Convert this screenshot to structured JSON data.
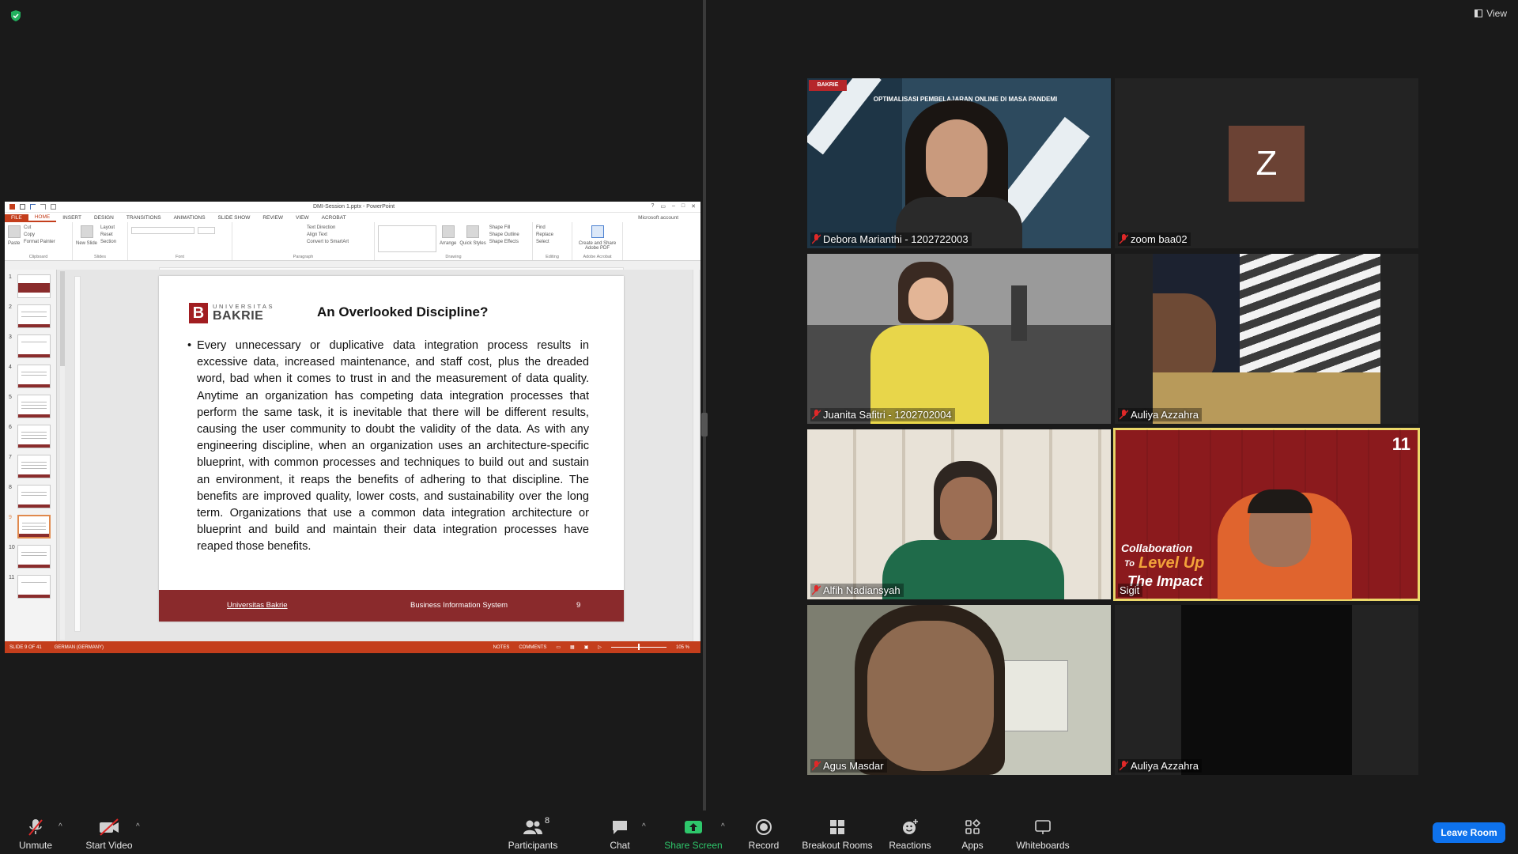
{
  "top": {
    "view_label": "View"
  },
  "powerpoint": {
    "doc_title": "DMI-Session 1.pptx - PowerPoint",
    "tabs": [
      "FILE",
      "HOME",
      "INSERT",
      "DESIGN",
      "TRANSITIONS",
      "ANIMATIONS",
      "SLIDE SHOW",
      "REVIEW",
      "VIEW",
      "ACROBAT"
    ],
    "account": "Microsoft account",
    "ribbon": {
      "paste": "Paste",
      "cut": "Cut",
      "copy": "Copy",
      "format_painter": "Format Painter",
      "clipboard": "Clipboard",
      "new_slide": "New Slide",
      "layout": "Layout",
      "reset": "Reset",
      "section": "Section",
      "slides": "Slides",
      "font": "Font",
      "paragraph": "Paragraph",
      "text_direction": "Text Direction",
      "align_text": "Align Text",
      "convert_smartart": "Convert to SmartArt",
      "drawing": "Drawing",
      "arrange": "Arrange",
      "quick_styles": "Quick Styles",
      "shape_fill": "Shape Fill",
      "shape_outline": "Shape Outline",
      "shape_effects": "Shape Effects",
      "find": "Find",
      "replace": "Replace",
      "select": "Select",
      "editing": "Editing",
      "create_pdf": "Create and Share Adobe PDF",
      "adobe_acrobat": "Adobe Acrobat"
    },
    "thumb_numbers": [
      "1",
      "2",
      "3",
      "4",
      "5",
      "6",
      "7",
      "8",
      "9",
      "10",
      "11"
    ],
    "selected_slide": 9,
    "slide": {
      "logo_top": "UNIVERSITAS",
      "logo_bottom": "BAKRIE",
      "title": "An Overlooked Discipline?",
      "body": "Every unnecessary or duplicative data integration process results in excessive data, increased maintenance, and staff cost, plus the dreaded word, bad when it comes to trust in and the measurement of data quality. Anytime an organization has competing data integration processes that perform the same task, it is inevitable that there will be different results, causing the user community to doubt the validity of the data. As with any engineering discipline, when an organization uses an architecture-specific blueprint, with common processes and techniques to build out and sustain an environment, it reaps the benefits of adhering to that discipline. The benefits are improved quality, lower costs, and sustainability over the long term. Organizations that use a common data integration architecture or blueprint and build and maintain their data integration processes have reaped those benefits.",
      "footer_left": "Universitas Bakrie",
      "footer_center": "Business Information System",
      "footer_page": "9"
    },
    "status": {
      "slide_of": "SLIDE 9 OF 41",
      "language": "GERMAN (GERMANY)",
      "notes": "NOTES",
      "comments": "COMMENTS",
      "zoom": "105 %"
    }
  },
  "participants": [
    {
      "name": "Debora Marianthi - 1202722003"
    },
    {
      "name": "zoom baa02",
      "avatar_letter": "Z"
    },
    {
      "name": "Juanita Safitri - 1202702004"
    },
    {
      "name": "Auliya Azzahra"
    },
    {
      "name": "Alfih Nadiansyah"
    },
    {
      "name": "Sigit",
      "banner_1": "Collaboration",
      "banner_2": "To",
      "banner_3": "Level Up",
      "banner_4": "The Impact",
      "badge": "11"
    },
    {
      "name": "Agus Masdar"
    },
    {
      "name": "Auliya Azzahra"
    }
  ],
  "debora_banner": "OPTIMALISASI PEMBELAJARAN ONLINE DI MASA PANDEMI",
  "toolbar": {
    "unmute": "Unmute",
    "start_video": "Start Video",
    "participants": "Participants",
    "participants_count": "8",
    "chat": "Chat",
    "share_screen": "Share Screen",
    "record": "Record",
    "breakout_rooms": "Breakout Rooms",
    "reactions": "Reactions",
    "apps": "Apps",
    "whiteboards": "Whiteboards",
    "leave_room": "Leave Room"
  },
  "colors": {
    "accent_blue": "#0e72ed",
    "share_green": "#2ec76b",
    "ppt_red": "#c43e1c",
    "active_speaker": "#ecd86a"
  }
}
